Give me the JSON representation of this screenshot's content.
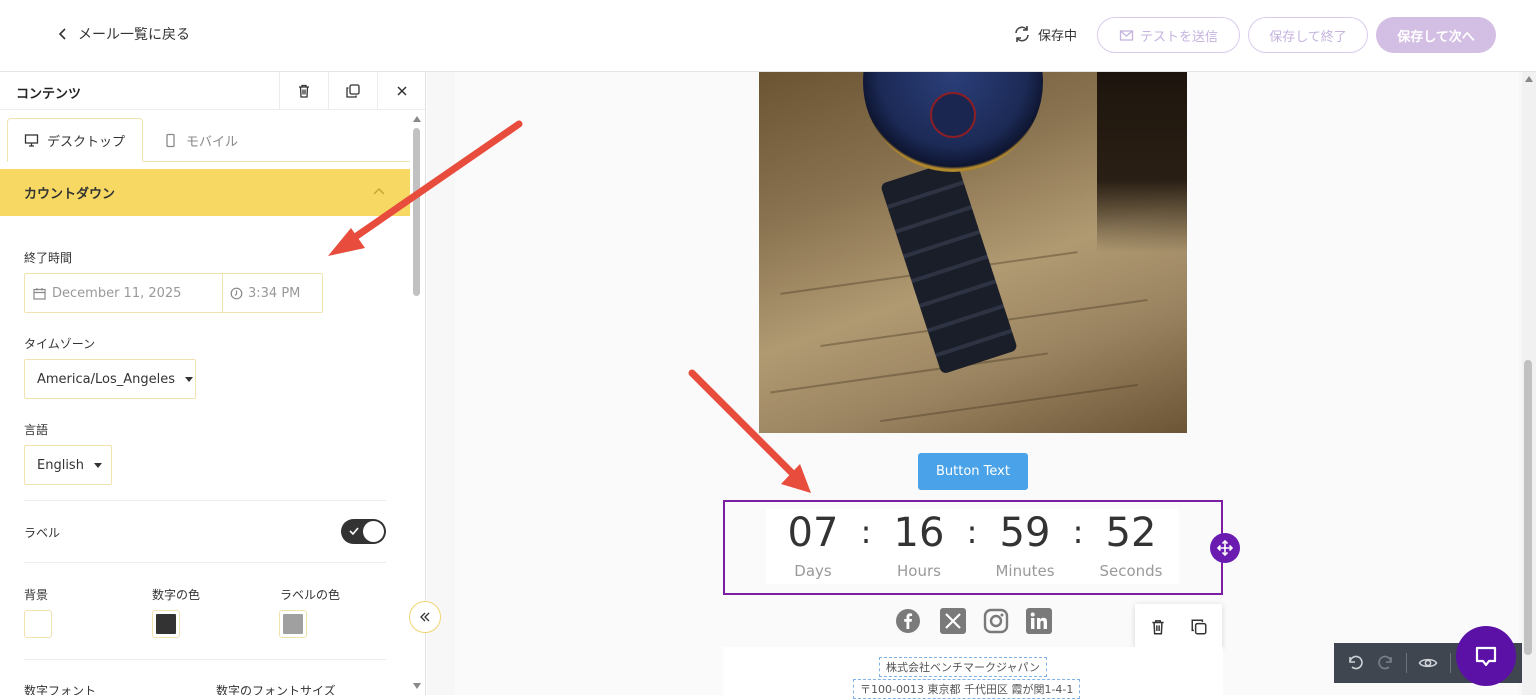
{
  "topbar": {
    "back_label": "メール一覧に戻る",
    "saving_label": "保存中",
    "send_test_label": "テストを送信",
    "save_exit_label": "保存して終了",
    "save_next_label": "保存して次へ"
  },
  "panel": {
    "title": "コンテンツ",
    "tabs": [
      {
        "label": "デスクトップ",
        "active": true
      },
      {
        "label": "モバイル",
        "active": false
      }
    ],
    "section_title": "カウントダウン",
    "end_time": {
      "label": "終了時間",
      "date": "December 11, 2025",
      "time": "3:34 PM"
    },
    "timezone": {
      "label": "タイムゾーン",
      "value": "America/Los_Angeles"
    },
    "language": {
      "label": "言語",
      "value": "English"
    },
    "label_toggle": {
      "label": "ラベル",
      "on": true
    },
    "colors": [
      {
        "label": "背景",
        "value": "#ffffff"
      },
      {
        "label": "数字の色",
        "value": "#333333"
      },
      {
        "label": "ラベルの色",
        "value": "#a0a0a0"
      }
    ],
    "digit_font_label": "数字フォント",
    "digit_font_size_label": "数字のフォントサイズ"
  },
  "canvas": {
    "button_text": "Button Text",
    "countdown": {
      "separator": ":",
      "units": [
        {
          "value": "07",
          "label": "Days"
        },
        {
          "value": "16",
          "label": "Hours"
        },
        {
          "value": "59",
          "label": "Minutes"
        },
        {
          "value": "52",
          "label": "Seconds"
        }
      ]
    },
    "social_icons": [
      "facebook-icon",
      "x-icon",
      "instagram-icon",
      "linkedin-icon"
    ],
    "footer": {
      "company": "株式会社ベンチマークジャパン",
      "address": "〒100-0013 東京都 千代田区 霞が関1-4-1"
    }
  },
  "colors": {
    "accent_yellow": "#f6d862",
    "purple": "#7b1fa2",
    "button_blue": "#4aa3e8",
    "annotation_red": "#e74c3c"
  }
}
